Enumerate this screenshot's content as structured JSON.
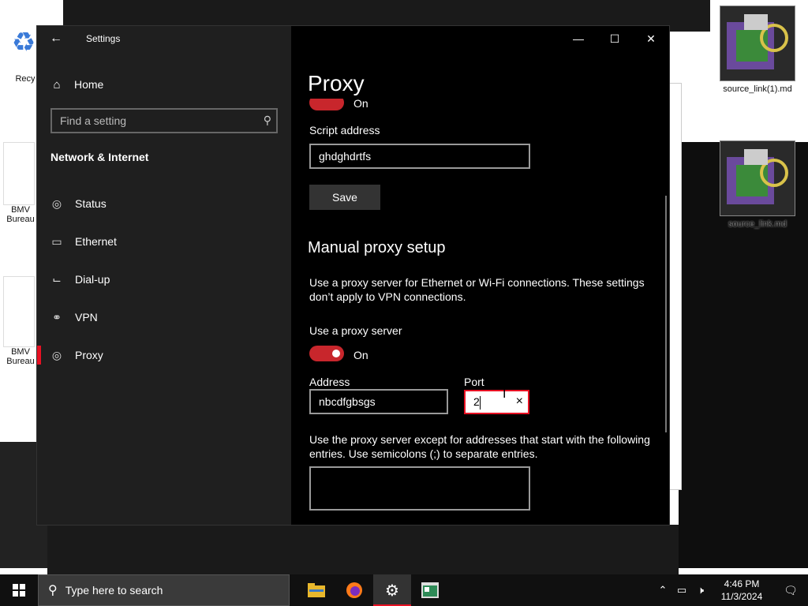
{
  "desktop": {
    "icons_right": [
      {
        "label": "source_link(1).md"
      },
      {
        "label": "source_link.md"
      }
    ],
    "icons_left": [
      {
        "label": "Recy"
      },
      {
        "label": "BMV Bureau"
      },
      {
        "label": "BMV Bureau"
      }
    ]
  },
  "window": {
    "title": "Settings",
    "back_icon": "back-arrow-icon",
    "minimize": "—",
    "maximize": "☐",
    "close": "✕"
  },
  "sidebar": {
    "home_label": "Home",
    "search_placeholder": "Find a setting",
    "section_title": "Network & Internet",
    "items": [
      {
        "label": "Status",
        "icon": "globe-icon",
        "glyph": "◎"
      },
      {
        "label": "Ethernet",
        "icon": "ethernet-icon",
        "glyph": "▭"
      },
      {
        "label": "Dial-up",
        "icon": "dialup-icon",
        "glyph": "⌙"
      },
      {
        "label": "VPN",
        "icon": "vpn-icon",
        "glyph": "⚭"
      },
      {
        "label": "Proxy",
        "icon": "globe-icon",
        "glyph": "◎",
        "active": true
      }
    ]
  },
  "main": {
    "page_title": "Proxy",
    "auto_toggle_state": "On",
    "script_address_label": "Script address",
    "script_address_value": "ghdghdrtfs",
    "save_label": "Save",
    "manual_heading": "Manual proxy setup",
    "manual_desc": "Use a proxy server for Ethernet or Wi-Fi connections. These settings don’t apply to VPN connections.",
    "use_proxy_label": "Use a proxy server",
    "use_proxy_state": "On",
    "address_label": "Address",
    "address_value": "nbcdfgbsgs",
    "port_label": "Port",
    "port_value": "2",
    "exceptions_desc": "Use the proxy server except for addresses that start with the following entries. Use semicolons (;) to separate entries.",
    "exceptions_value": ""
  },
  "taskbar": {
    "search_placeholder": "Type here to search",
    "time": "4:46 PM",
    "date": "11/3/2024"
  },
  "colors": {
    "accent": "#e81123",
    "toggle_on": "#c8262c",
    "sidebar_bg": "#1f1f1f",
    "main_bg": "#000000"
  }
}
